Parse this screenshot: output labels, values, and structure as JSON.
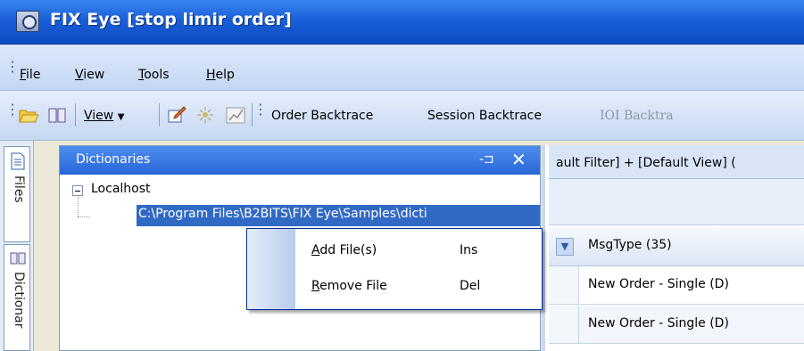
{
  "window": {
    "title": "FIX Eye [stop limir order]",
    "app_icon": "fix-eye-app-icon"
  },
  "menubar": {
    "items": [
      "File",
      "View",
      "Tools",
      "Help"
    ]
  },
  "toolbar": {
    "view_dropdown": "View",
    "icons": [
      "open-folder-icon",
      "dictionary-book-icon",
      "edit-document-icon",
      "filter-sparkle-icon",
      "chart-icon"
    ],
    "order_backtrace": "Order Backtrace",
    "session_backtrace": "Session Backtrace",
    "ioi_backtrace": "IOI Backtra"
  },
  "side_tabs": [
    "Files",
    "Dictionar"
  ],
  "dictionaries_panel": {
    "title": "Dictionaries",
    "tree": {
      "root": "Localhost",
      "child": "C:\\Program Files\\B2BITS\\FIX Eye\\Samples\\dicti"
    }
  },
  "context_menu": {
    "items": [
      {
        "label": "Add File(s)",
        "shortcut": "Ins"
      },
      {
        "label": "Remove File",
        "shortcut": "Del"
      }
    ]
  },
  "right_pane": {
    "filter_text": "ault Filter] + [Default View] (",
    "grid": {
      "column": "MsgType (35)",
      "rows": [
        "New Order - Single (D)",
        "New Order - Single (D)"
      ]
    }
  },
  "colors": {
    "title_blue": "#1a5fd8",
    "selection": "#316ac5",
    "panel_header": "#2866d6"
  }
}
